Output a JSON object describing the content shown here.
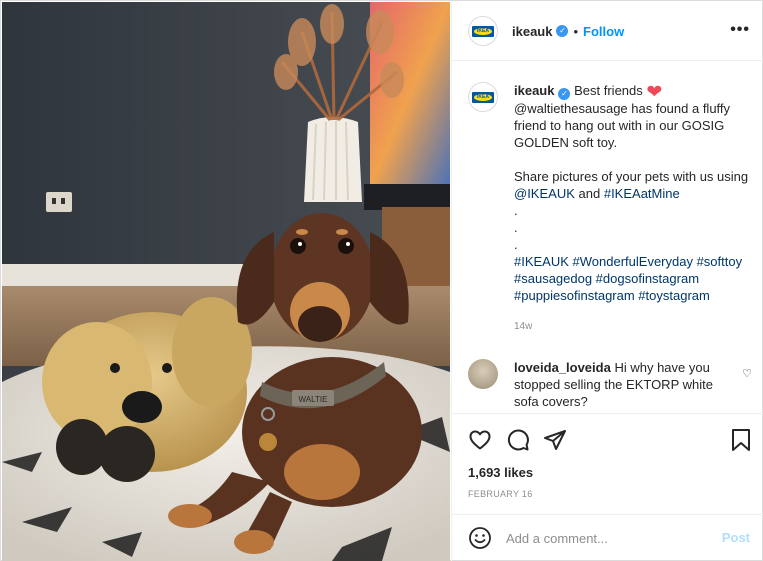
{
  "header": {
    "username": "ikeauk",
    "separator": "•",
    "follow_label": "Follow",
    "more_label": "•••"
  },
  "logo": {
    "text": "IKEA"
  },
  "caption": {
    "username": "ikeauk",
    "title": "Best friends",
    "heart": "❤",
    "line1": "@waltiethesausage has found a fluffy friend to hang out with in our GOSIG GOLDEN soft toy.",
    "line2a": "Share pictures of your pets with us using",
    "mention": "@IKEAUK",
    "and": "and",
    "hashtag_mine": "#IKEAatMine",
    "dot": ".",
    "hashtags": "#IKEAUK #WonderfulEveryday #softtoy #sausagedog #dogsofinstagram #puppiesofinstagram #toystagram",
    "time": "14w"
  },
  "comment": {
    "username": "loveida_loveida",
    "text": "Hi why have you stopped selling the EKTORP white sofa covers?",
    "heart": "♡"
  },
  "stats": {
    "likes": "1,693 likes",
    "date": "FEBRUARY 16"
  },
  "add_comment": {
    "placeholder": "Add a comment...",
    "post_label": "Post"
  },
  "icons": [
    "heart-icon",
    "comment-icon",
    "share-icon",
    "bookmark-icon",
    "emoji-icon",
    "verified-icon",
    "more-icon"
  ],
  "colors": {
    "link": "#0095f6",
    "hashtag": "#00376b",
    "muted": "#8e8e8e",
    "verified": "#3897f0"
  },
  "photo": {
    "subject": "dachshund with plush dog toy",
    "collar_text": "WALTIE"
  }
}
